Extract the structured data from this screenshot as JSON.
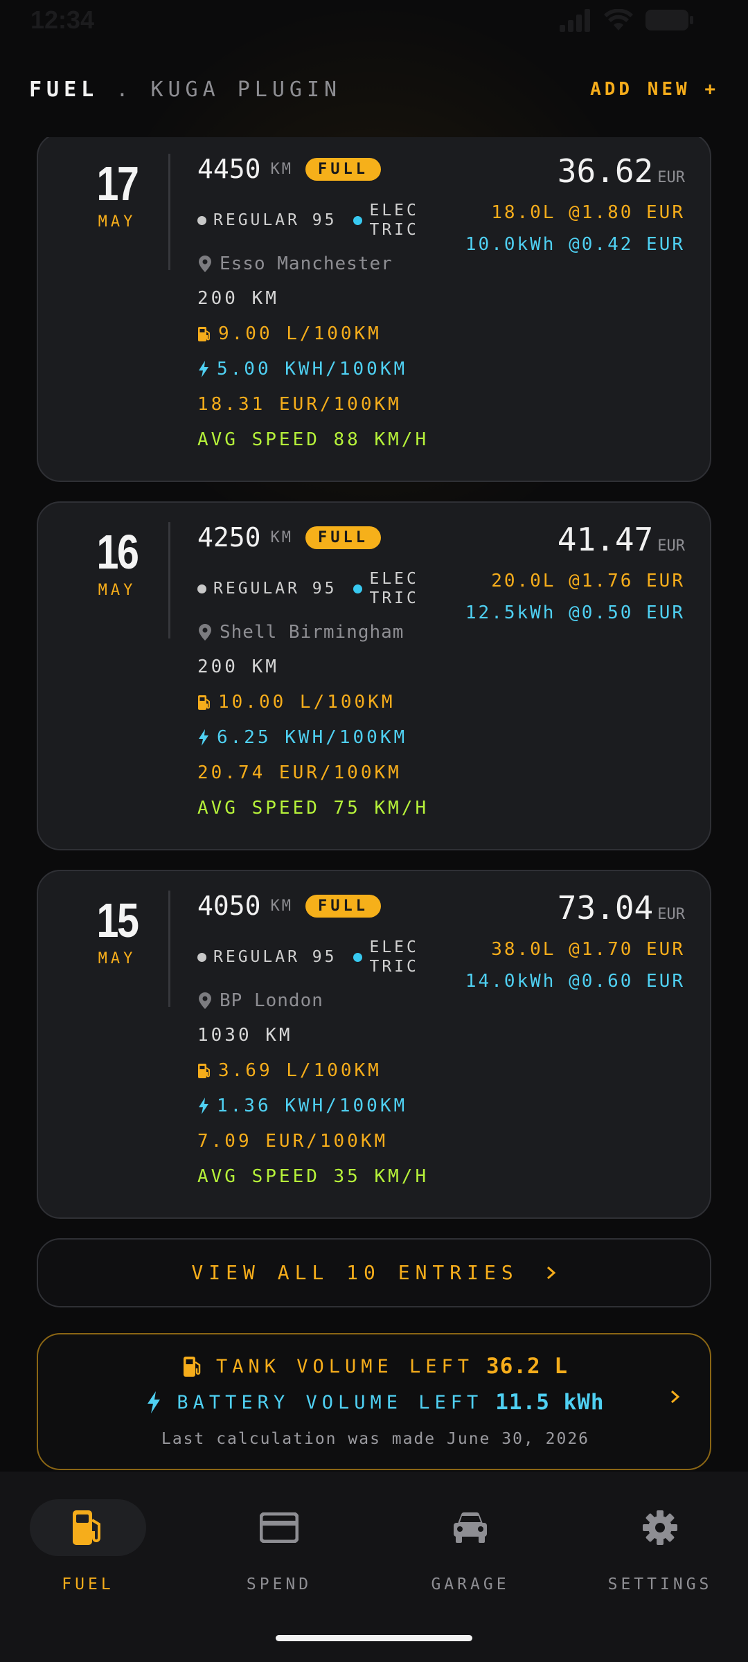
{
  "status_bar": {
    "time": "12:34"
  },
  "header": {
    "title": "FUEL",
    "separator": ".",
    "vehicle": "KUGA PLUGIN",
    "add_new": "ADD NEW +"
  },
  "entries": [
    {
      "day": "17",
      "month": "MAY",
      "odometer": "4450",
      "odometer_unit": "KM",
      "badge": "FULL",
      "fuel_type": "REGULAR 95",
      "elec_type_line1": "ELEC",
      "elec_type_line2": "TRIC",
      "station": "Esso Manchester",
      "distance": "200 KM",
      "fuel_consumption": "9.00 L/100KM",
      "elec_consumption": "5.00 KWH/100KM",
      "cost_per_100": "18.31 EUR/100KM",
      "avg_speed": "AVG SPEED 88 KM/H",
      "total": "36.62",
      "currency": "EUR",
      "fuel_rate": "18.0L @1.80 EUR",
      "elec_rate": "10.0kWh @0.42 EUR"
    },
    {
      "day": "16",
      "month": "MAY",
      "odometer": "4250",
      "odometer_unit": "KM",
      "badge": "FULL",
      "fuel_type": "REGULAR 95",
      "elec_type_line1": "ELEC",
      "elec_type_line2": "TRIC",
      "station": "Shell Birmingham",
      "distance": "200 KM",
      "fuel_consumption": "10.00 L/100KM",
      "elec_consumption": "6.25 KWH/100KM",
      "cost_per_100": "20.74 EUR/100KM",
      "avg_speed": "AVG SPEED 75 KM/H",
      "total": "41.47",
      "currency": "EUR",
      "fuel_rate": "20.0L @1.76 EUR",
      "elec_rate": "12.5kWh @0.50 EUR"
    },
    {
      "day": "15",
      "month": "MAY",
      "odometer": "4050",
      "odometer_unit": "KM",
      "badge": "FULL",
      "fuel_type": "REGULAR 95",
      "elec_type_line1": "ELEC",
      "elec_type_line2": "TRIC",
      "station": "BP London",
      "distance": "1030 KM",
      "fuel_consumption": "3.69 L/100KM",
      "elec_consumption": "1.36 KWH/100KM",
      "cost_per_100": "7.09 EUR/100KM",
      "avg_speed": "AVG SPEED 35 KM/H",
      "total": "73.04",
      "currency": "EUR",
      "fuel_rate": "38.0L @1.70 EUR",
      "elec_rate": "14.0kWh @0.60 EUR"
    }
  ],
  "view_all": "VIEW ALL 10 ENTRIES",
  "summary": {
    "tank_label": "TANK VOLUME LEFT",
    "tank_value": "36.2 L",
    "battery_label": "BATTERY VOLUME LEFT",
    "battery_value": "11.5 kWh",
    "note": "Last calculation was made June 30, 2026"
  },
  "nav": [
    {
      "label": "FUEL",
      "icon": "fuel-pump-icon",
      "active": true
    },
    {
      "label": "SPEND",
      "icon": "credit-card-icon",
      "active": false
    },
    {
      "label": "GARAGE",
      "icon": "car-icon",
      "active": false
    },
    {
      "label": "SETTINGS",
      "icon": "gear-icon",
      "active": false
    }
  ],
  "colors": {
    "accent": "#f6ad1b",
    "electric": "#4fd0f2",
    "speed": "#b6f23a",
    "card": "#1b1c1f",
    "background": "#0b0b0c"
  }
}
